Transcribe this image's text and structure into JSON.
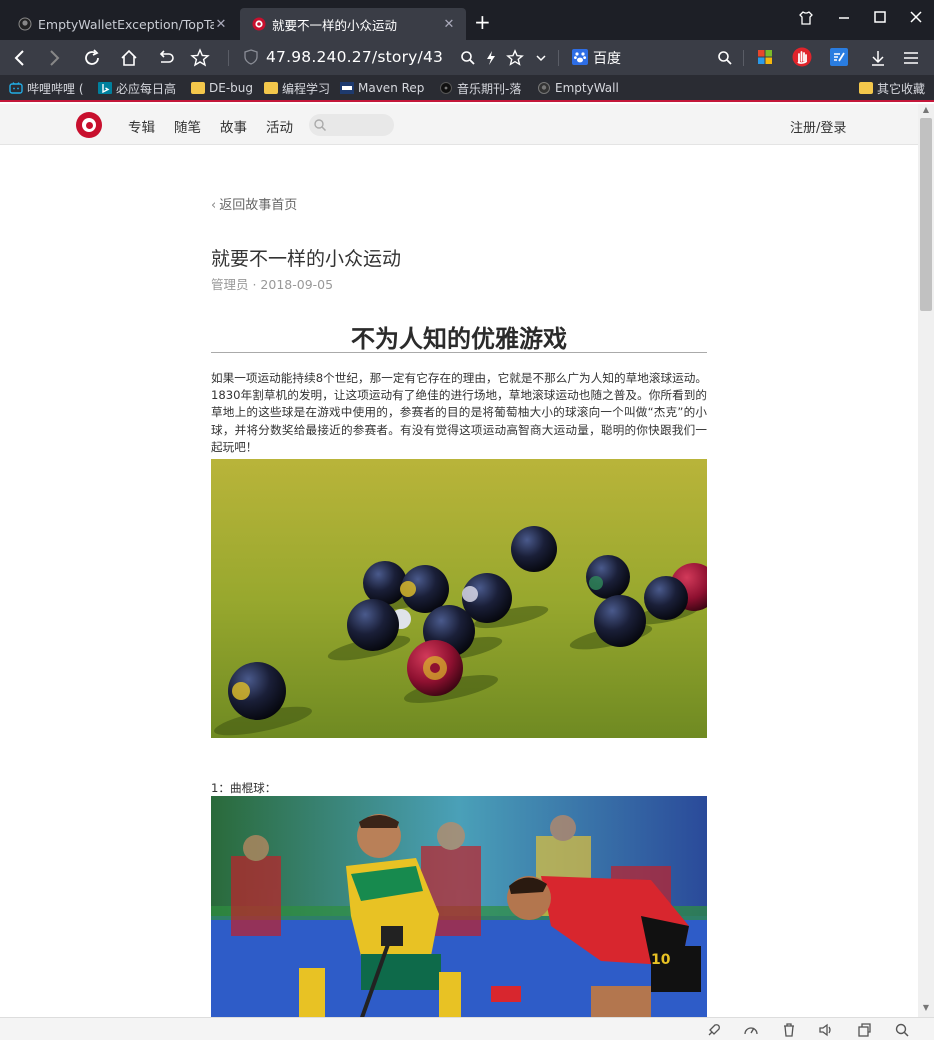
{
  "tabs": [
    {
      "title": "EmptyWalletException/TopTal",
      "active": false
    },
    {
      "title": "就要不一样的小众运动",
      "active": true
    }
  ],
  "address": {
    "url": "47.98.240.27/story/43",
    "search_engine": "百度"
  },
  "bookmarks": [
    "哔哩哔哩 (",
    "必应每日高",
    "DE-bug",
    "编程学习",
    "Maven Rep",
    "音乐期刊-落",
    "EmptyWall",
    "其它收藏"
  ],
  "site": {
    "nav": [
      "专辑",
      "随笔",
      "故事",
      "活动"
    ],
    "login": "注册/登录",
    "brand_color": "#c8102e"
  },
  "article": {
    "back_link": "返回故事首页",
    "title": "就要不一样的小众运动",
    "meta": "管理员 · 2018-09-05",
    "heading": "不为人知的优雅游戏",
    "paragraph": "如果一项运动能持续8个世纪，那一定有它存在的理由，它就是不那么广为人知的草地滚球运动。1830年割草机的发明，让这项运动有了绝佳的进行场地，草地滚球运动也随之普及。你所看到的草地上的这些球是在游戏中使用的，参赛者的目的是将葡萄柚大小的球滚向一个叫做“杰克”的小球，并将分数奖给最接近的参赛者。有没有觉得这项运动高智商大运动量，聪明的你快跟我们一起玩吧！",
    "caption": "1：曲棍球："
  },
  "theme": {
    "chrome_dark": "#1d1f26",
    "toolbar": "#3a3d46",
    "accent": "#c4173a"
  }
}
